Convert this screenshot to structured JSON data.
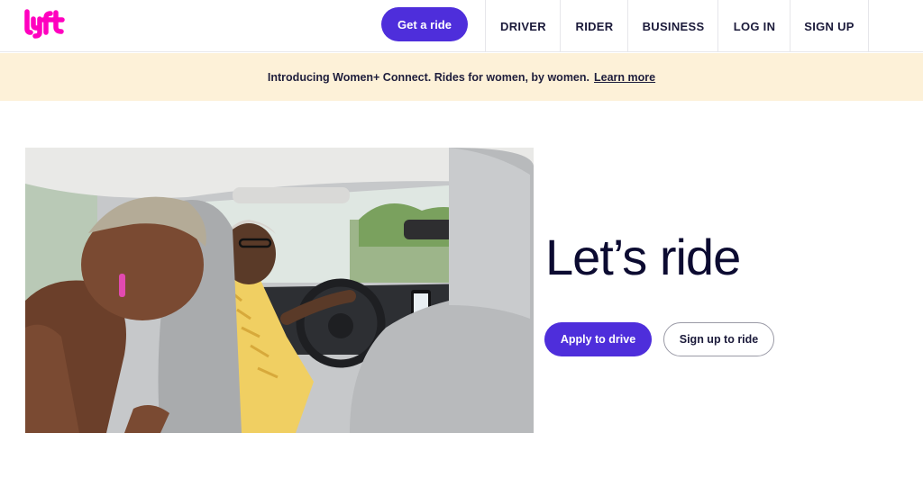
{
  "brand": {
    "logo_text": "lyft",
    "logo_color": "#ff00bf",
    "accent_color": "#4e2edb"
  },
  "header": {
    "cta_label": "Get a ride",
    "nav": [
      "DRIVER",
      "RIDER",
      "BUSINESS",
      "LOG IN",
      "SIGN UP"
    ]
  },
  "banner": {
    "text": "Introducing Women+ Connect. Rides for women, by women.",
    "link_label": "Learn more",
    "background": "#fdf1d8"
  },
  "hero": {
    "headline": "Let’s ride",
    "primary_button": "Apply to drive",
    "secondary_button": "Sign up to ride",
    "image_icon": "rideshare-photo"
  }
}
